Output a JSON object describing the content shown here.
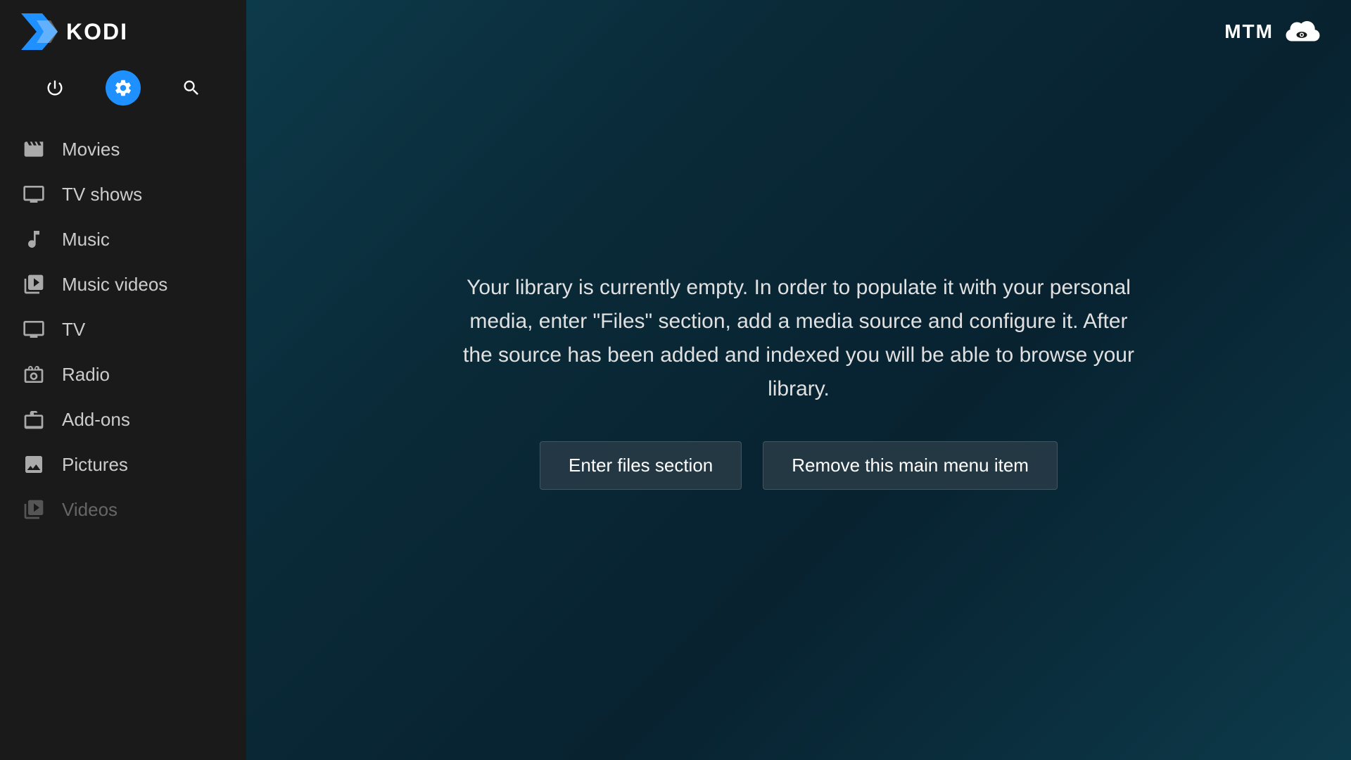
{
  "app": {
    "name": "KODI",
    "top_right_label": "MTM"
  },
  "sidebar": {
    "controls": [
      {
        "id": "power",
        "label": "Power",
        "icon": "power-icon",
        "active": false
      },
      {
        "id": "settings",
        "label": "Settings",
        "icon": "settings-icon",
        "active": true
      },
      {
        "id": "search",
        "label": "Search",
        "icon": "search-icon",
        "active": false
      }
    ],
    "nav_items": [
      {
        "id": "movies",
        "label": "Movies",
        "icon": "movies-icon"
      },
      {
        "id": "tv-shows",
        "label": "TV shows",
        "icon": "tv-shows-icon"
      },
      {
        "id": "music",
        "label": "Music",
        "icon": "music-icon"
      },
      {
        "id": "music-videos",
        "label": "Music videos",
        "icon": "music-videos-icon"
      },
      {
        "id": "tv",
        "label": "TV",
        "icon": "tv-icon"
      },
      {
        "id": "radio",
        "label": "Radio",
        "icon": "radio-icon"
      },
      {
        "id": "add-ons",
        "label": "Add-ons",
        "icon": "add-ons-icon"
      },
      {
        "id": "pictures",
        "label": "Pictures",
        "icon": "pictures-icon"
      },
      {
        "id": "videos",
        "label": "Videos",
        "icon": "videos-icon",
        "dimmed": true
      }
    ]
  },
  "main": {
    "library_message": "Your library is currently empty. In order to populate it with your personal media, enter \"Files\" section, add a media source and configure it. After the source has been added and indexed you will be able to browse your library.",
    "enter_files_label": "Enter files section",
    "remove_menu_item_label": "Remove this main menu item"
  }
}
